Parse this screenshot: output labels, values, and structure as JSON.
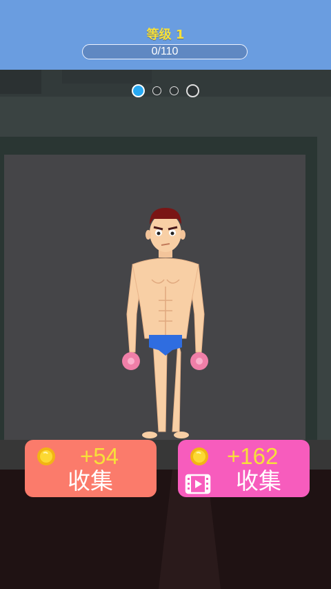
{
  "header": {
    "level_label": "等级 1",
    "xp_text": "0/110",
    "xp_progress": 0
  },
  "stage_dots": {
    "count": 4,
    "active_index": 0
  },
  "rewards": {
    "collect": {
      "amount": "+54",
      "label": "收集",
      "icon": "coin-icon"
    },
    "video_collect": {
      "amount": "+162",
      "label": "收集",
      "icons": [
        "coin-icon",
        "video-icon"
      ]
    }
  },
  "colors": {
    "header_bg": "#6a9de0",
    "level_text": "#f7e13a",
    "active_dot": "#28a9f2",
    "collect_button": "#fb7b6b",
    "video_collect_button": "#f75cbd",
    "amount_text": "#f7e03a"
  }
}
